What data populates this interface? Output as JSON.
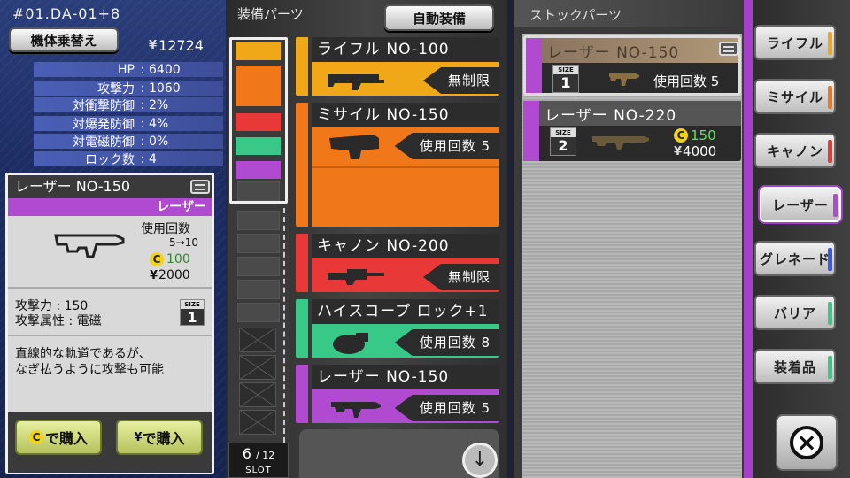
{
  "header": {
    "mech_code": "#01.DA-01+8",
    "switch_button": "機体乗替え",
    "credits": "12724"
  },
  "stats": [
    {
      "label": "HP",
      "value": "6400"
    },
    {
      "label": "攻撃力",
      "value": "1060"
    },
    {
      "label": "対衝撃防御",
      "value": "2%"
    },
    {
      "label": "対爆発防御",
      "value": "4%"
    },
    {
      "label": "対電磁防御",
      "value": "0%"
    },
    {
      "label": "ロック数",
      "value": "4"
    }
  ],
  "detail": {
    "name": "レーザー NO-150",
    "category": "レーザー",
    "usage_label": "使用回数",
    "usage_range": "5→10",
    "c_cost": "100",
    "yen_cost": "2000",
    "attack_line": "攻撃力 : 150",
    "attr_line": "攻撃属性 : 電磁",
    "size": "1",
    "description_1": "直線的な軌道であるが、",
    "description_2": "なぎ払うように攻撃も可能",
    "buy_c_label": "で購入",
    "buy_yen_label": "で購入"
  },
  "equip": {
    "title": "装備パーツ",
    "auto_button": "自動装備",
    "slot_used": "6",
    "slot_total": "/ 12",
    "slot_label": "SLOT",
    "parts": [
      {
        "name": "ライフル  NO-100",
        "tag": "無制限",
        "color": "#f0a818"
      },
      {
        "name": "ミサイル  NO-150",
        "tag": "使用回数 5",
        "color": "#f07818"
      },
      {
        "name": "キャノン  NO-200",
        "tag": "無制限",
        "color": "#e83838"
      },
      {
        "name": "ハイスコープ ロック+1",
        "tag": "使用回数 8",
        "color": "#38c888"
      },
      {
        "name": "レーザー  NO-150",
        "tag": "使用回数 5",
        "color": "#b04ad0"
      }
    ]
  },
  "stock": {
    "title": "ストックパーツ",
    "items": [
      {
        "name": "レーザー  NO-150",
        "size": "1",
        "usage": "使用回数 5"
      },
      {
        "name": "レーザー  NO-220",
        "size": "2",
        "c_cost": "150",
        "yen_cost": "4000"
      }
    ]
  },
  "categories": [
    {
      "label": "ライフル",
      "color": "#f0a818"
    },
    {
      "label": "ミサイル",
      "color": "#f07818"
    },
    {
      "label": "キャノン",
      "color": "#e83838"
    },
    {
      "label": "レーザー",
      "color": "#b04ad0"
    },
    {
      "label": "グレネード",
      "color": "#3858e8"
    },
    {
      "label": "バリア",
      "color": "#38c888"
    },
    {
      "label": "装着品",
      "color": "#38c888"
    }
  ],
  "icons": {
    "close": "close-icon",
    "down": "arrow-down-icon",
    "c_coin": "C",
    "yen": "yen-icon"
  }
}
